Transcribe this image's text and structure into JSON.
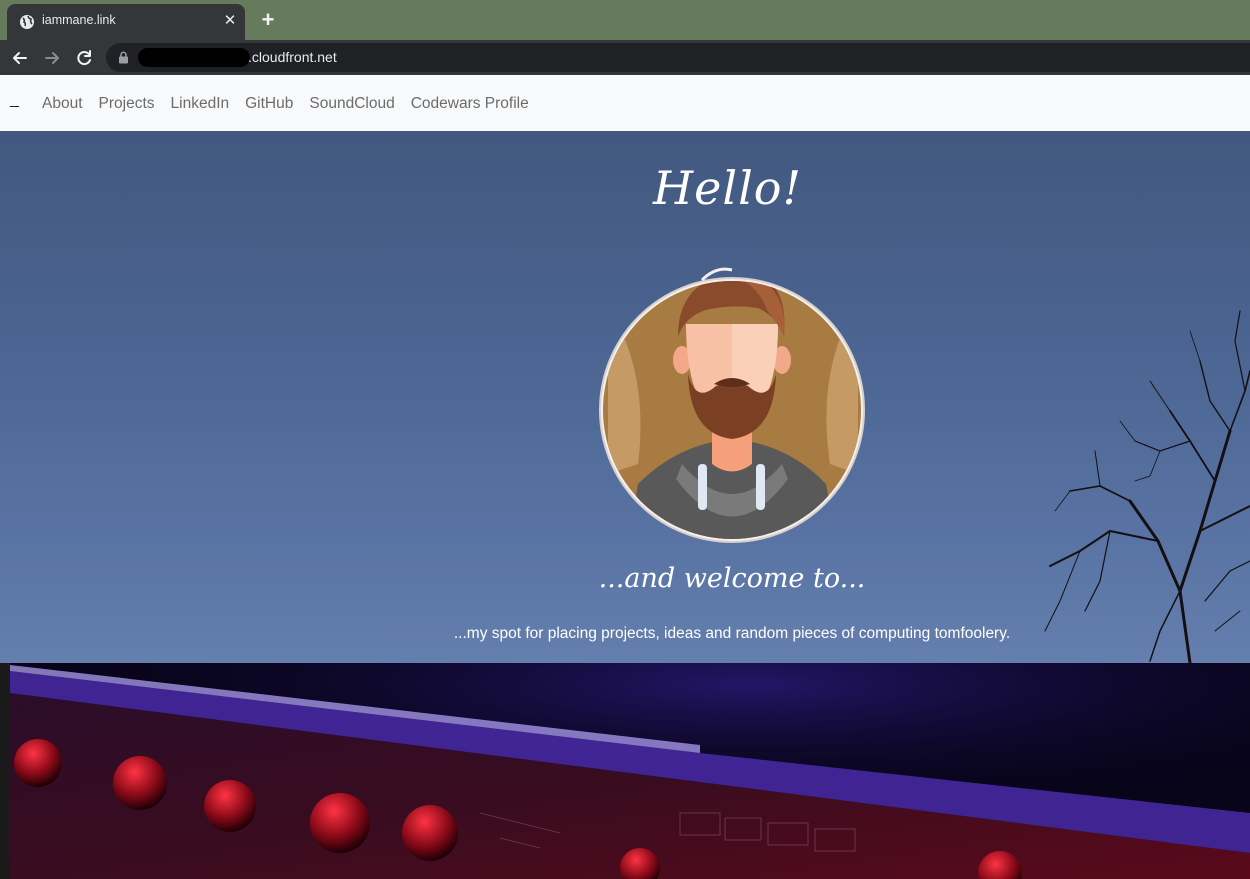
{
  "browser": {
    "tab_title": "iammane.link",
    "tab_close": "✕",
    "new_tab": "+",
    "url_suffix": ".cloudfront.net"
  },
  "nav": {
    "brand": "_",
    "links": [
      "About",
      "Projects",
      "LinkedIn",
      "GitHub",
      "SoundCloud",
      "Codewars Profile"
    ]
  },
  "hero": {
    "greeting": "Hello!",
    "welcome": "...and welcome to...",
    "tagline": "...my spot for placing projects, ideas and random pieces of computing tomfoolery."
  },
  "colors": {
    "tabstrip": "#667b5c",
    "chrome_dark": "#35363a",
    "nav_bg": "#f8f9fa",
    "hero_sky": "#4b6491"
  }
}
